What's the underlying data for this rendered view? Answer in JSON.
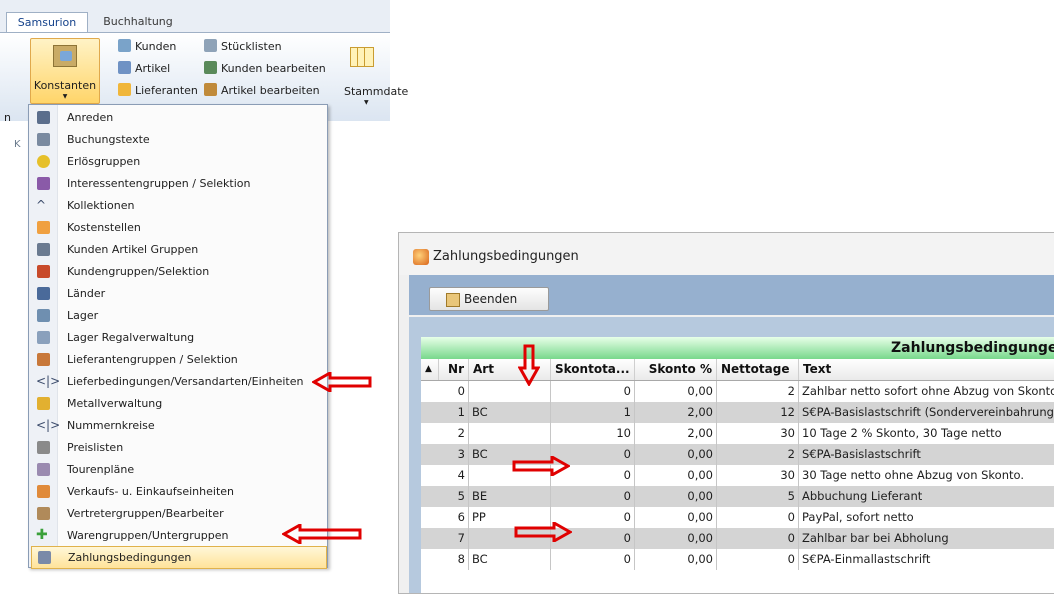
{
  "ribbon": {
    "tabs": [
      "Samsurion",
      "Buchhaltung"
    ],
    "konstanten_label": "Konstanten",
    "left_cut_label": "n",
    "group_label": "K",
    "items": [
      {
        "label": "Kunden",
        "icon": "customers-icon"
      },
      {
        "label": "Artikel",
        "icon": "article-icon"
      },
      {
        "label": "Lieferanten",
        "icon": "supplier-icon"
      },
      {
        "label": "Stücklisten",
        "icon": "bom-icon"
      },
      {
        "label": "Kunden bearbeiten",
        "icon": "edit-customers-icon"
      },
      {
        "label": "Artikel bearbeiten",
        "icon": "edit-article-icon"
      }
    ],
    "stammdaten_label": "Stammdate"
  },
  "menu": {
    "items": [
      "Anreden",
      "Buchungstexte",
      "Erlösgruppen",
      "Interessentengruppen / Selektion",
      "Kollektionen",
      "Kostenstellen",
      "Kunden Artikel Gruppen",
      "Kundengruppen/Selektion",
      "Länder",
      "Lager",
      "Lager Regalverwaltung",
      "Lieferantengruppen / Selektion",
      "Lieferbedingungen/Versandarten/Einheiten",
      "Metallverwaltung",
      "Nummernkreise",
      "Preislisten",
      "Tourenpläne",
      "Verkaufs- u. Einkaufseinheiten",
      "Vertretergruppen/Bearbeiter",
      "Warengruppen/Untergruppen",
      "Zahlungsbedingungen"
    ],
    "selected_index": 20
  },
  "dialog": {
    "title": "Zahlungsbedingungen",
    "beenden_label": "Beenden",
    "grid_title": "Zahlungsbedingungen",
    "sort_glyph": "▲",
    "columns": [
      "Nr",
      "Art",
      "Skontota...",
      "Skonto %",
      "Nettotage",
      "Text"
    ],
    "rows": [
      {
        "nr": "0",
        "art": "",
        "skontotage": "0",
        "skonto": "0,00",
        "nettotage": "2",
        "text": "Zahlbar netto sofort ohne Abzug von Skonto"
      },
      {
        "nr": "1",
        "art": "BC",
        "skontotage": "1",
        "skonto": "2,00",
        "nettotage": "12",
        "text": "S€PA-Basislastschrift (Sondervereinbahrung)"
      },
      {
        "nr": "2",
        "art": "",
        "skontotage": "10",
        "skonto": "2,00",
        "nettotage": "30",
        "text": "10 Tage 2 % Skonto, 30 Tage netto"
      },
      {
        "nr": "3",
        "art": "BC",
        "skontotage": "0",
        "skonto": "0,00",
        "nettotage": "2",
        "text": "S€PA-Basislastschrift"
      },
      {
        "nr": "4",
        "art": "",
        "skontotage": "0",
        "skonto": "0,00",
        "nettotage": "30",
        "text": "30 Tage netto ohne Abzug von Skonto."
      },
      {
        "nr": "5",
        "art": "BE",
        "skontotage": "0",
        "skonto": "0,00",
        "nettotage": "5",
        "text": "Abbuchung Lieferant"
      },
      {
        "nr": "6",
        "art": "PP",
        "skontotage": "0",
        "skonto": "0,00",
        "nettotage": "0",
        "text": "PayPal, sofort netto"
      },
      {
        "nr": "7",
        "art": "",
        "skontotage": "0",
        "skonto": "0,00",
        "nettotage": "0",
        "text": "Zahlbar bar bei Abholung"
      },
      {
        "nr": "8",
        "art": "BC",
        "skontotage": "0",
        "skonto": "0,00",
        "nettotage": "0",
        "text": "S€PA-Einmallastschrift"
      }
    ]
  },
  "colors": {
    "arrow": "#e00000",
    "selection": "#ffe39a",
    "grid_header": "#78d88c",
    "toolbar": "#96b0cf"
  }
}
